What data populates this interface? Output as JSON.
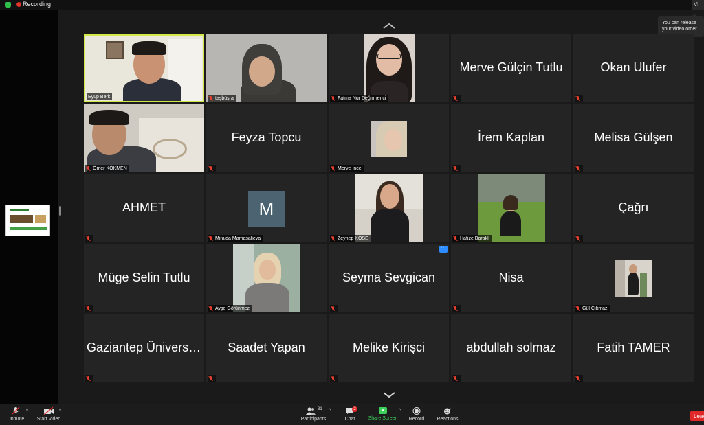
{
  "topbar": {
    "recording_label": "Recording",
    "view_label": "Vi"
  },
  "tooltip": {
    "line1": "You can release",
    "line2": "your video order"
  },
  "tiles": [
    {
      "name": "Eyüp Berk",
      "mode": "video"
    },
    {
      "name": "taşbüşra",
      "mode": "video"
    },
    {
      "name": "Fatma Nur Değirmenci",
      "mode": "video"
    },
    {
      "name": "Merve Gülçin Tutlu",
      "mode": "name"
    },
    {
      "name": "Okan Ulufer",
      "mode": "name"
    },
    {
      "name": "Ömer KÖKMEN",
      "mode": "video"
    },
    {
      "name": "Feyza Topcu",
      "mode": "name"
    },
    {
      "name": "Merve İnce",
      "mode": "video"
    },
    {
      "name": "İrem Kaplan",
      "mode": "name"
    },
    {
      "name": "Melisa Gülşen",
      "mode": "name"
    },
    {
      "name": "AHMET",
      "mode": "name"
    },
    {
      "name": "Miraida Mamasalieva",
      "mode": "avatar",
      "avatar_letter": "M"
    },
    {
      "name": "Zeynep KOSE",
      "mode": "video"
    },
    {
      "name": "Hafize Baraklı",
      "mode": "video"
    },
    {
      "name": "Çağrı",
      "mode": "name"
    },
    {
      "name": "Müge Selin Tutlu",
      "mode": "name"
    },
    {
      "name": "Ayşe Görünmez",
      "mode": "video"
    },
    {
      "name": "Seyma Sevgican",
      "mode": "name"
    },
    {
      "name": "Nisa",
      "mode": "name"
    },
    {
      "name": "Gül Çıkmaz",
      "mode": "video"
    },
    {
      "name": "Gaziantep Üniversitesi",
      "mode": "name"
    },
    {
      "name": "Saadet Yapan",
      "mode": "name"
    },
    {
      "name": "Melike Kirişci",
      "mode": "name"
    },
    {
      "name": "abdullah solmaz",
      "mode": "name"
    },
    {
      "name": "Fatih TAMER",
      "mode": "name"
    }
  ],
  "toolbar": {
    "unmute_label": "Unmute",
    "start_video_label": "Start Video",
    "participants_label": "Participants",
    "participants_count": "31",
    "chat_label": "Chat",
    "chat_badge": "2",
    "share_screen_label": "Share Screen",
    "record_label": "Record",
    "reactions_label": "Reactions",
    "leave_label": "Leave"
  },
  "colors": {
    "active_speaker_border": "#d4e84a",
    "share_green": "#3ccf5b",
    "leave_red": "#e02828",
    "avatar_bg": "#4c6471"
  }
}
